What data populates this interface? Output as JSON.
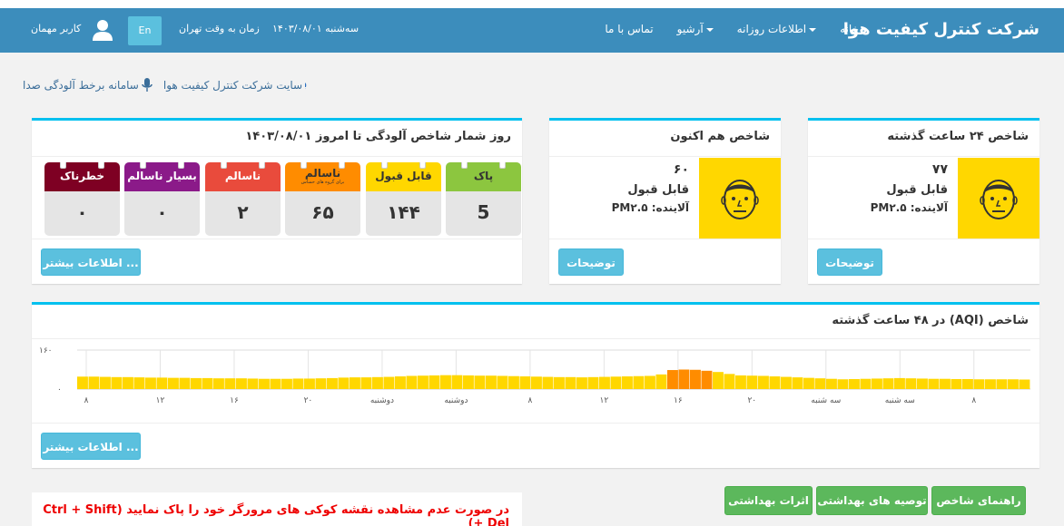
{
  "navbar": {
    "brand": "شرکت کنترل کیفیت هوا",
    "items": [
      {
        "label": "خانه",
        "caret": false
      },
      {
        "label": "اطلاعات روزانه",
        "caret": true
      },
      {
        "label": "آرشیو",
        "caret": true
      },
      {
        "label": "تماس با ما",
        "caret": false
      }
    ],
    "date": "سه‌شنبه ۱۴۰۳/۰۸/۰۱",
    "timezone": "زمان به وقت تهران",
    "lang": "En",
    "user": "کاربر مهمان"
  },
  "links": {
    "company_site": "سایت شرکت کنترل کیفیت هوا",
    "voice_system": "سامانه برخط آلودگی صدا"
  },
  "box24": {
    "title": "شاخص ۲۴ ساعت گذشته",
    "value": "۷۷",
    "category": "قابل قبول",
    "pollutant": "آلاینده: PM۲.۵",
    "button": "توضیحات",
    "color": "#ffd700"
  },
  "boxNow": {
    "title": "شاخص هم اکنون",
    "value": "۶۰",
    "category": "قابل قبول",
    "pollutant": "آلاینده: PM۲.۵",
    "button": "توضیحات",
    "color": "#ffd700"
  },
  "counter": {
    "title": "روز شمار شاخص آلودگی تا امروز ۱۴۰۳/۰۸/۰۱",
    "button": "اطلاعات بیشتر ...",
    "items": [
      {
        "label": "پاک",
        "sub": "",
        "value": "5",
        "color": "#8cc63f"
      },
      {
        "label": "قابل قبول",
        "sub": "",
        "value": "۱۴۴",
        "color": "#ffd700"
      },
      {
        "label": "ناسالم",
        "sub": "برای گروه های حساس",
        "value": "۶۵",
        "color": "#ff8c00"
      },
      {
        "label": "ناسالم",
        "sub": "",
        "value": "۲",
        "color": "#e94b3c"
      },
      {
        "label": "بسیار ناسالم",
        "sub": "",
        "value": "۰",
        "color": "#8b1a89"
      },
      {
        "label": "خطرناک",
        "sub": "",
        "value": "۰",
        "color": "#7e0023"
      }
    ]
  },
  "chartBox": {
    "title": "شاخص (AQI) در ۴۸ ساعت گذشته",
    "button": "اطلاعات بیشتر ..."
  },
  "chart_data": {
    "type": "bar",
    "ylim": [
      0,
      160
    ],
    "yticks": [
      "۰",
      "۱۶۰"
    ],
    "values": [
      51,
      51,
      50,
      49,
      49,
      48,
      47,
      47,
      46,
      46,
      45,
      45,
      44,
      44,
      44,
      43,
      42,
      42,
      42,
      43,
      43,
      44,
      45,
      47,
      48,
      48,
      49,
      50,
      52,
      54,
      55,
      56,
      57,
      57,
      56,
      55,
      55,
      54,
      53,
      52,
      51,
      50,
      49,
      49,
      48,
      49,
      50,
      51,
      52,
      53,
      54,
      60,
      78,
      80,
      79,
      75,
      70,
      62,
      56,
      55,
      54,
      52,
      50,
      48,
      46,
      44,
      42,
      40,
      41,
      42,
      43,
      44,
      45,
      44,
      43,
      42,
      42,
      41,
      41,
      40,
      40,
      40,
      40,
      39
    ],
    "colors": {
      "moderate": "#ffd700",
      "usg": "#ff8c00"
    },
    "usg_threshold": 100,
    "xticks": [
      "۸",
      "۱۲",
      "۱۶",
      "۲۰",
      "دوشنبه",
      "دوشنبه",
      "۸",
      "۱۲",
      "۱۶",
      "۲۰",
      "سه شنبه",
      "سه شنبه",
      "۸"
    ],
    "grid": true
  },
  "buttons": {
    "guide": "راهنمای شاخص",
    "recommendations": "توصیه های بهداشتی",
    "effects": "اثرات بهداشتی"
  },
  "warning": "در صورت عدم مشاهده نقشه کوکی های مرورگر خود را پاک نمایید (Ctrl + Shift + Del)"
}
